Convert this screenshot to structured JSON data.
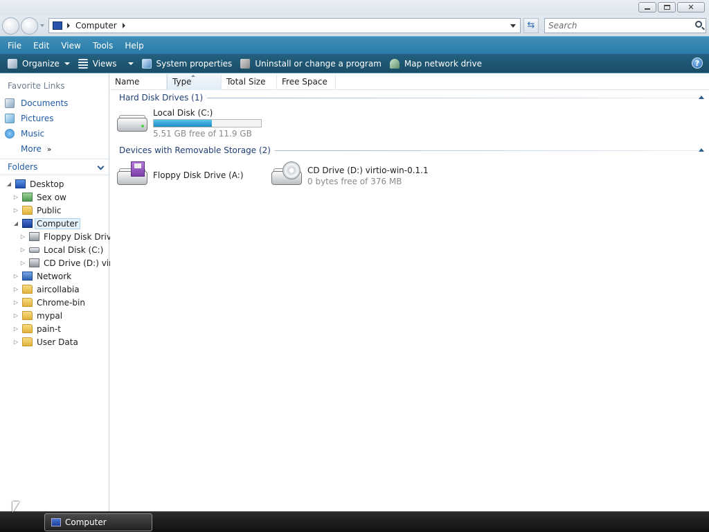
{
  "window": {
    "controls": [
      "minimize",
      "maximize",
      "close"
    ],
    "close_glyph": "✕"
  },
  "address": {
    "path": "Computer",
    "search_placeholder": "Search",
    "refresh_glyph": "⇆"
  },
  "menu": [
    "File",
    "Edit",
    "View",
    "Tools",
    "Help"
  ],
  "commands": {
    "organize": "Organize",
    "views": "Views",
    "system_properties": "System properties",
    "uninstall": "Uninstall or change a program",
    "map_drive": "Map network drive",
    "help_glyph": "?"
  },
  "favorites": {
    "title": "Favorite Links",
    "items": [
      "Documents",
      "Pictures",
      "Music"
    ],
    "more": "More",
    "more_glyph": "»"
  },
  "folders": {
    "title": "Folders",
    "tree": [
      {
        "label": "Desktop",
        "level": 0,
        "expander": "◢",
        "icon": "desktop-icon"
      },
      {
        "label": "Sex ow",
        "level": 1,
        "expander": "▷",
        "icon": "user-folder-icon"
      },
      {
        "label": "Public",
        "level": 1,
        "expander": "▷",
        "icon": "folder-icon"
      },
      {
        "label": "Computer",
        "level": 1,
        "expander": "◢",
        "icon": "computer-icon",
        "selected": true
      },
      {
        "label": "Floppy Disk Drive",
        "level": 2,
        "expander": "▷",
        "icon": "floppy-icon"
      },
      {
        "label": "Local Disk (C:)",
        "level": 2,
        "expander": "▷",
        "icon": "disk-icon"
      },
      {
        "label": "CD Drive (D:) virtio",
        "level": 2,
        "expander": "▷",
        "icon": "cd-icon"
      },
      {
        "label": "Network",
        "level": 1,
        "expander": "▷",
        "icon": "network-icon"
      },
      {
        "label": "aircollabia",
        "level": 1,
        "expander": "▷",
        "icon": "folder-icon"
      },
      {
        "label": "Chrome-bin",
        "level": 1,
        "expander": "▷",
        "icon": "folder-icon"
      },
      {
        "label": "mypal",
        "level": 1,
        "expander": "▷",
        "icon": "folder-icon"
      },
      {
        "label": "pain-t",
        "level": 1,
        "expander": "▷",
        "icon": "folder-icon"
      },
      {
        "label": "User Data",
        "level": 1,
        "expander": "▷",
        "icon": "folder-icon"
      }
    ]
  },
  "columns": [
    "Name",
    "Type",
    "Total Size",
    "Free Space"
  ],
  "groups": {
    "hard_disks": {
      "label": "Hard Disk Drives (1)",
      "drives": [
        {
          "name": "Local Disk (C:)",
          "free_text": "5.51 GB free of 11.9 GB",
          "used_fraction": 0.54
        }
      ]
    },
    "removable": {
      "label": "Devices with Removable Storage (2)",
      "drives": [
        {
          "name": "Floppy Disk Drive (A:)"
        },
        {
          "name": "CD Drive (D:) virtio-win-0.1.1",
          "free_text": "0 bytes free of 376 MB"
        }
      ]
    }
  },
  "taskbar": {
    "active_window": "Computer"
  }
}
